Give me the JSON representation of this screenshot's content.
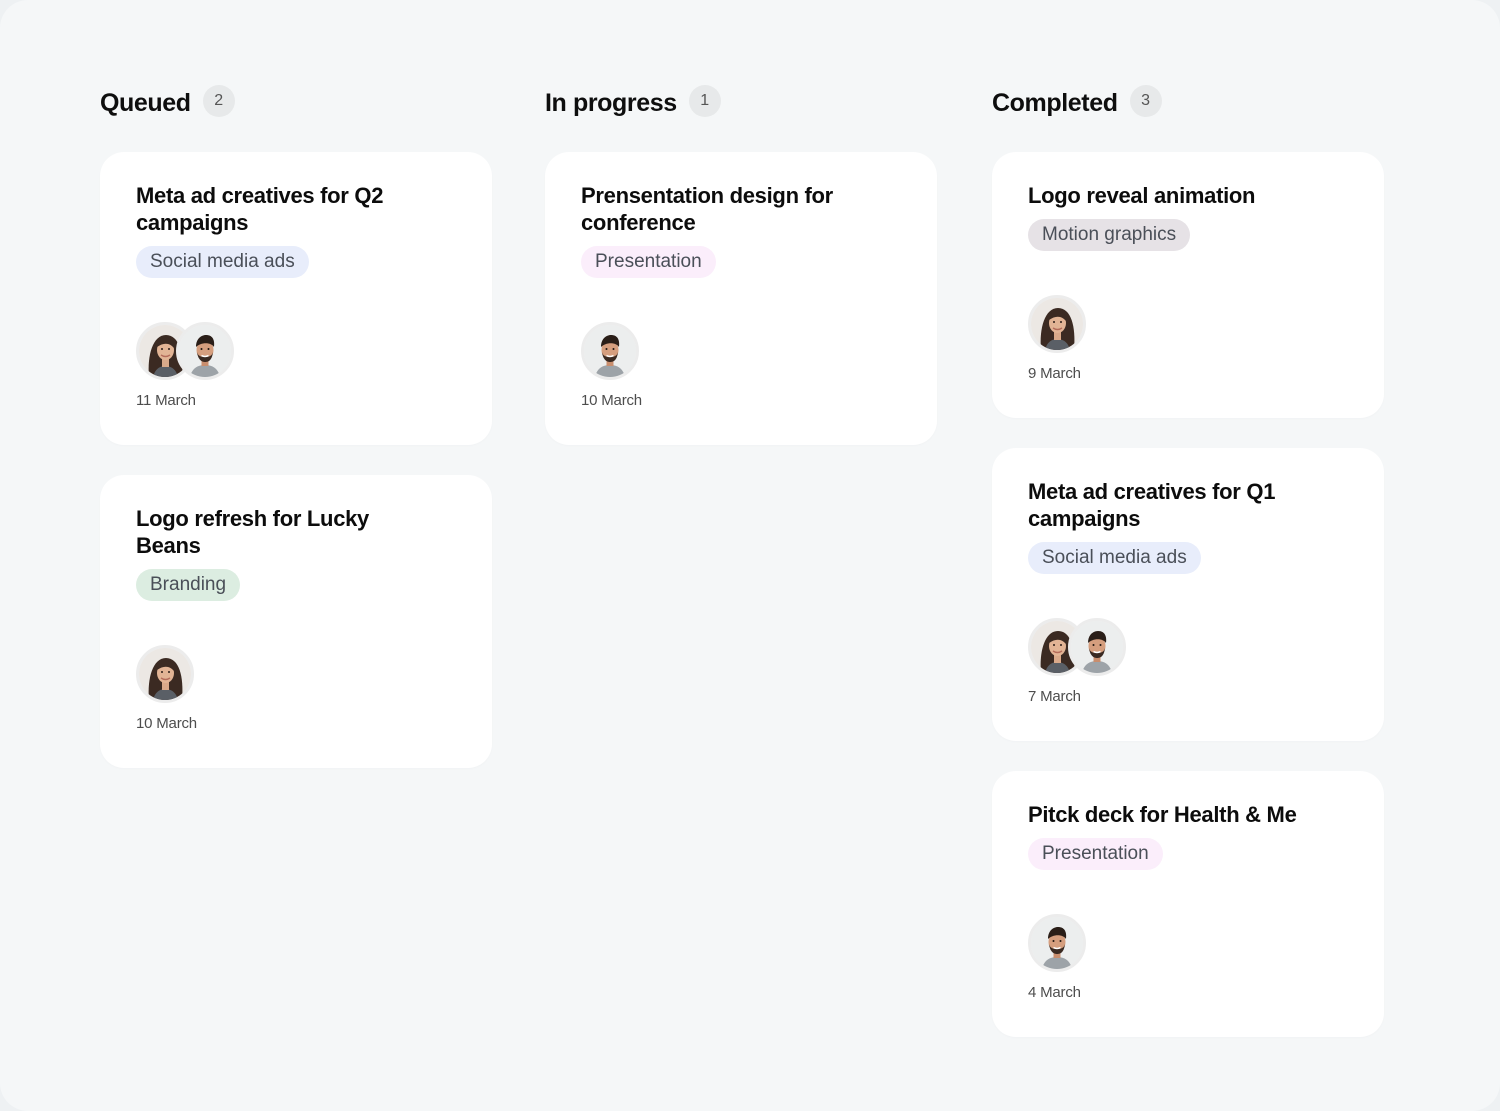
{
  "columns": [
    {
      "title": "Queued",
      "count": "2",
      "cards": [
        {
          "title": "Meta ad creatives for Q2 campaigns",
          "tag": "Social media ads",
          "tag_color": "#e8edfb",
          "assignees": [
            "woman-avatar",
            "man-avatar"
          ],
          "date": "11 March"
        },
        {
          "title": "Logo refresh for Lucky Beans",
          "tag": "Branding",
          "tag_color": "#dcede1",
          "assignees": [
            "woman-avatar"
          ],
          "date": "10 March"
        }
      ]
    },
    {
      "title": "In progress",
      "count": "1",
      "cards": [
        {
          "title": "Prensentation design for conference",
          "tag": "Presentation",
          "tag_color": "#fbeefb",
          "assignees": [
            "man-avatar"
          ],
          "date": "10 March"
        }
      ]
    },
    {
      "title": "Completed",
      "count": "3",
      "cards": [
        {
          "title": "Logo reveal animation",
          "tag": "Motion graphics",
          "tag_color": "#e6e2e6",
          "assignees": [
            "woman-avatar"
          ],
          "date": "9 March"
        },
        {
          "title": "Meta ad creatives for Q1 campaigns",
          "tag": "Social media ads",
          "tag_color": "#e8edfb",
          "assignees": [
            "woman-avatar",
            "man-avatar"
          ],
          "date": "7 March"
        },
        {
          "title": "Pitck deck for Health & Me",
          "tag": "Presentation",
          "tag_color": "#fbeefb",
          "assignees": [
            "man-avatar"
          ],
          "date": "4 March"
        }
      ]
    }
  ]
}
